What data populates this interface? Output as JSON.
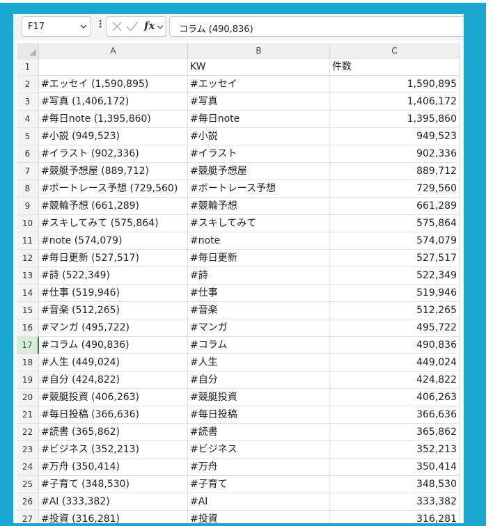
{
  "formula_bar": {
    "name_box": "F17",
    "fx_label": "fx",
    "formula": "コラム (490,836)"
  },
  "grid": {
    "columns": [
      "A",
      "B",
      "C"
    ],
    "rows": [
      {
        "num": "1",
        "a": "",
        "b": "KW",
        "c": "件数"
      },
      {
        "num": "2",
        "a": "#エッセイ (1,590,895)",
        "b": "#エッセイ",
        "c": "1,590,895"
      },
      {
        "num": "3",
        "a": "#写真 (1,406,172)",
        "b": "#写真",
        "c": "1,406,172"
      },
      {
        "num": "4",
        "a": "#毎日note (1,395,860)",
        "b": "#毎日note",
        "c": "1,395,860"
      },
      {
        "num": "5",
        "a": "#小説 (949,523)",
        "b": "#小説",
        "c": "949,523"
      },
      {
        "num": "6",
        "a": "#イラスト (902,336)",
        "b": "#イラスト",
        "c": "902,336"
      },
      {
        "num": "7",
        "a": "#競艇予想屋 (889,712)",
        "b": "#競艇予想屋",
        "c": "889,712"
      },
      {
        "num": "8",
        "a": "#ボートレース予想 (729,560)",
        "b": "#ボートレース予想",
        "c": "729,560"
      },
      {
        "num": "9",
        "a": "#競輪予想 (661,289)",
        "b": "#競輪予想",
        "c": "661,289"
      },
      {
        "num": "10",
        "a": "#スキしてみて (575,864)",
        "b": "#スキしてみて",
        "c": "575,864"
      },
      {
        "num": "11",
        "a": "#note (574,079)",
        "b": "#note",
        "c": "574,079"
      },
      {
        "num": "12",
        "a": "#毎日更新 (527,517)",
        "b": "#毎日更新",
        "c": "527,517"
      },
      {
        "num": "13",
        "a": "#詩 (522,349)",
        "b": "#詩",
        "c": "522,349"
      },
      {
        "num": "14",
        "a": "#仕事 (519,946)",
        "b": "#仕事",
        "c": "519,946"
      },
      {
        "num": "15",
        "a": "#音楽 (512,265)",
        "b": "#音楽",
        "c": "512,265"
      },
      {
        "num": "16",
        "a": "#マンガ (495,722)",
        "b": "#マンガ",
        "c": "495,722"
      },
      {
        "num": "17",
        "a": "#コラム (490,836)",
        "b": "#コラム",
        "c": "490,836"
      },
      {
        "num": "18",
        "a": "#人生 (449,024)",
        "b": "#人生",
        "c": "449,024"
      },
      {
        "num": "19",
        "a": "#自分 (424,822)",
        "b": "#自分",
        "c": "424,822"
      },
      {
        "num": "20",
        "a": "#競艇投資 (406,263)",
        "b": "#競艇投資",
        "c": "406,263"
      },
      {
        "num": "21",
        "a": "#毎日投稿 (366,636)",
        "b": "#毎日投稿",
        "c": "366,636"
      },
      {
        "num": "22",
        "a": "#読書 (365,862)",
        "b": "#読書",
        "c": "365,862"
      },
      {
        "num": "23",
        "a": "#ビジネス (352,213)",
        "b": "#ビジネス",
        "c": "352,213"
      },
      {
        "num": "24",
        "a": "#万舟 (350,414)",
        "b": "#万舟",
        "c": "350,414"
      },
      {
        "num": "25",
        "a": "#子育て (348,530)",
        "b": "#子育て",
        "c": "348,530"
      },
      {
        "num": "26",
        "a": "#AI (333,382)",
        "b": "#AI",
        "c": "333,382"
      },
      {
        "num": "27",
        "a": "#投資 (316,281)",
        "b": "#投資",
        "c": "316,281"
      }
    ]
  },
  "selected_row": "17",
  "colors": {
    "frame": "#1aa7d2",
    "selection": "#2e7d4a"
  }
}
